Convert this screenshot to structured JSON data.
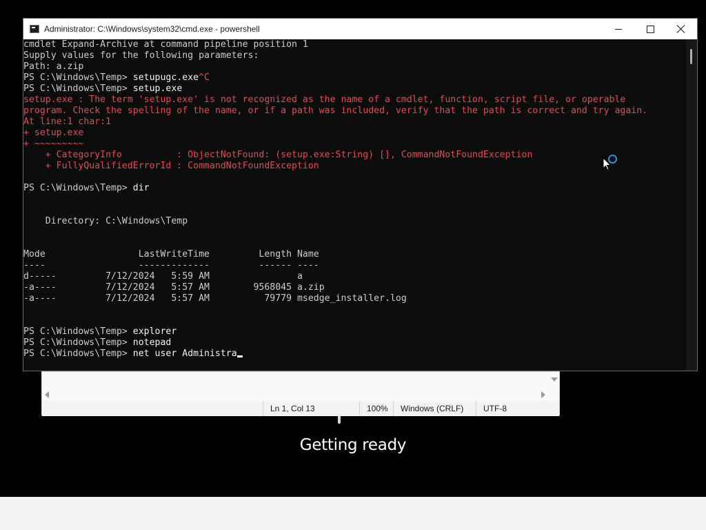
{
  "console": {
    "title": "Administrator: C:\\Windows\\system32\\cmd.exe - powershell",
    "lines": [
      {
        "type": "normal",
        "text": "cmdlet Expand-Archive at command pipeline position 1"
      },
      {
        "type": "normal",
        "text": "Supply values for the following parameters:"
      },
      {
        "type": "normal",
        "text": "Path: a.zip"
      },
      {
        "type": "prompt",
        "prompt": "PS C:\\Windows\\Temp> ",
        "cmd": "setupugc.exe",
        "ctrl": "^C"
      },
      {
        "type": "prompt",
        "prompt": "PS C:\\Windows\\Temp> ",
        "cmd": "setup.exe",
        "ctrl": ""
      },
      {
        "type": "error",
        "text": "setup.exe : The term 'setup.exe' is not recognized as the name of a cmdlet, function, script file, or operable"
      },
      {
        "type": "error",
        "text": "program. Check the spelling of the name, or if a path was included, verify that the path is correct and try again."
      },
      {
        "type": "error",
        "text": "At line:1 char:1"
      },
      {
        "type": "error",
        "text": "+ setup.exe"
      },
      {
        "type": "error",
        "text": "+ ~~~~~~~~~"
      },
      {
        "type": "error",
        "text": "    + CategoryInfo          : ObjectNotFound: (setup.exe:String) [], CommandNotFoundException"
      },
      {
        "type": "error",
        "text": "    + FullyQualifiedErrorId : CommandNotFoundException"
      },
      {
        "type": "normal",
        "text": ""
      },
      {
        "type": "prompt",
        "prompt": "PS C:\\Windows\\Temp> ",
        "cmd": "dir",
        "ctrl": ""
      },
      {
        "type": "normal",
        "text": ""
      },
      {
        "type": "normal",
        "text": ""
      },
      {
        "type": "normal",
        "text": "    Directory: C:\\Windows\\Temp"
      },
      {
        "type": "normal",
        "text": ""
      },
      {
        "type": "normal",
        "text": ""
      },
      {
        "type": "normal",
        "text": "Mode                 LastWriteTime         Length Name"
      },
      {
        "type": "normal",
        "text": "----                 -------------         ------ ----"
      },
      {
        "type": "normal",
        "text": "d-----         7/12/2024   5:59 AM                a"
      },
      {
        "type": "normal",
        "text": "-a----         7/12/2024   5:57 AM        9568045 a.zip"
      },
      {
        "type": "normal",
        "text": "-a----         7/12/2024   5:57 AM          79779 msedge_installer.log"
      },
      {
        "type": "normal",
        "text": ""
      },
      {
        "type": "normal",
        "text": ""
      },
      {
        "type": "prompt",
        "prompt": "PS C:\\Windows\\Temp> ",
        "cmd": "explorer",
        "ctrl": ""
      },
      {
        "type": "prompt",
        "prompt": "PS C:\\Windows\\Temp> ",
        "cmd": "notepad",
        "ctrl": ""
      },
      {
        "type": "prompt",
        "prompt": "PS C:\\Windows\\Temp> ",
        "cmd": "net user Administra",
        "ctrl": "",
        "cursor": true
      }
    ],
    "icons": {
      "app": "cmd-icon",
      "minimize": "minimize-icon",
      "maximize": "maximize-icon",
      "close": "close-icon"
    }
  },
  "notepad": {
    "status": {
      "position": "Ln 1, Col 13",
      "zoom": "100%",
      "line_ending": "Windows (CRLF)",
      "encoding": "UTF-8"
    }
  },
  "overlay": {
    "message": "Getting ready"
  },
  "colors": {
    "console_bg": "#0c0c0c",
    "console_fg": "#cccccc",
    "error_fg": "#e74856",
    "busy_ring": "#2f8fe0"
  }
}
